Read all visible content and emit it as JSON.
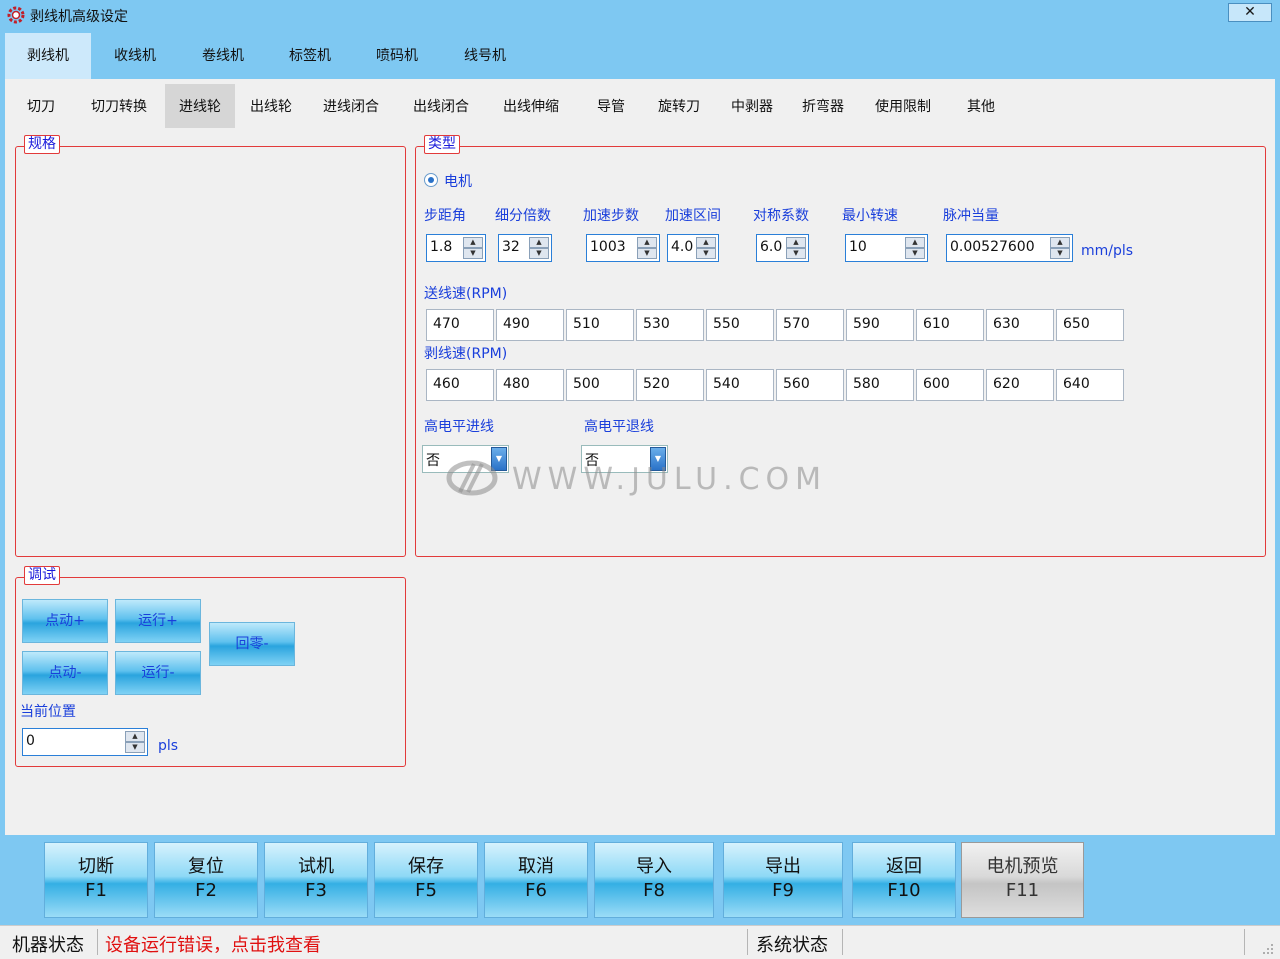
{
  "window": {
    "title": "剥线机高级设定",
    "close_label": "✕"
  },
  "top_tabs": [
    "剥线机",
    "收线机",
    "卷线机",
    "标签机",
    "喷码机",
    "线号机"
  ],
  "sub_tabs": [
    "切刀",
    "切刀转换",
    "进线轮",
    "出线轮",
    "进线闭合",
    "出线闭合",
    "出线伸缩",
    "导管",
    "旋转刀",
    "中剥器",
    "折弯器",
    "使用限制",
    "其他"
  ],
  "spec_group": {
    "label": "规格"
  },
  "type_group": {
    "label": "类型",
    "radio_label": "电机",
    "params": [
      {
        "label": "步距角",
        "value": "1.8"
      },
      {
        "label": "细分倍数",
        "value": "32"
      },
      {
        "label": "加速步数",
        "value": "1003"
      },
      {
        "label": "加速区间",
        "value": "4.0"
      },
      {
        "label": "对称系数",
        "value": "6.0"
      },
      {
        "label": "最小转速",
        "value": "10"
      },
      {
        "label": "脉冲当量",
        "value": "0.00527600"
      }
    ],
    "pulse_unit": "mm/pls",
    "feed_speed_label": "送线速(RPM)",
    "feed_speeds": [
      "470",
      "490",
      "510",
      "530",
      "550",
      "570",
      "590",
      "610",
      "630",
      "650"
    ],
    "strip_speed_label": "剥线速(RPM)",
    "strip_speeds": [
      "460",
      "480",
      "500",
      "520",
      "540",
      "560",
      "580",
      "600",
      "620",
      "640"
    ],
    "high_level_feed": {
      "label": "高电平进线",
      "value": "否"
    },
    "high_level_retract": {
      "label": "高电平退线",
      "value": "否"
    }
  },
  "debug_group": {
    "label": "调试",
    "buttons": {
      "jog_plus": "点动+",
      "run_plus": "运行+",
      "home_minus": "回零-",
      "jog_minus": "点动-",
      "run_minus": "运行-"
    },
    "position_label": "当前位置",
    "position_value": "0",
    "position_unit": "pls"
  },
  "watermark": "WWW.JULU.COM",
  "function_buttons": [
    {
      "name": "切断",
      "key": "F1"
    },
    {
      "name": "复位",
      "key": "F2"
    },
    {
      "name": "试机",
      "key": "F3"
    },
    {
      "name": "保存",
      "key": "F5"
    },
    {
      "name": "取消",
      "key": "F6"
    },
    {
      "name": "导入",
      "key": "F8"
    },
    {
      "name": "导出",
      "key": "F9"
    },
    {
      "name": "返回",
      "key": "F10"
    },
    {
      "name": "电机预览",
      "key": "F11"
    }
  ],
  "status_bar": {
    "machine_label": "机器状态",
    "machine_message": "设备运行错误，点击我查看",
    "system_label": "系统状态",
    "system_value": ""
  },
  "colors": {
    "accent": "#7ec8f2",
    "label_blue": "#1a3fdb",
    "group_border": "#e23a3a",
    "error_red": "#e01010"
  }
}
